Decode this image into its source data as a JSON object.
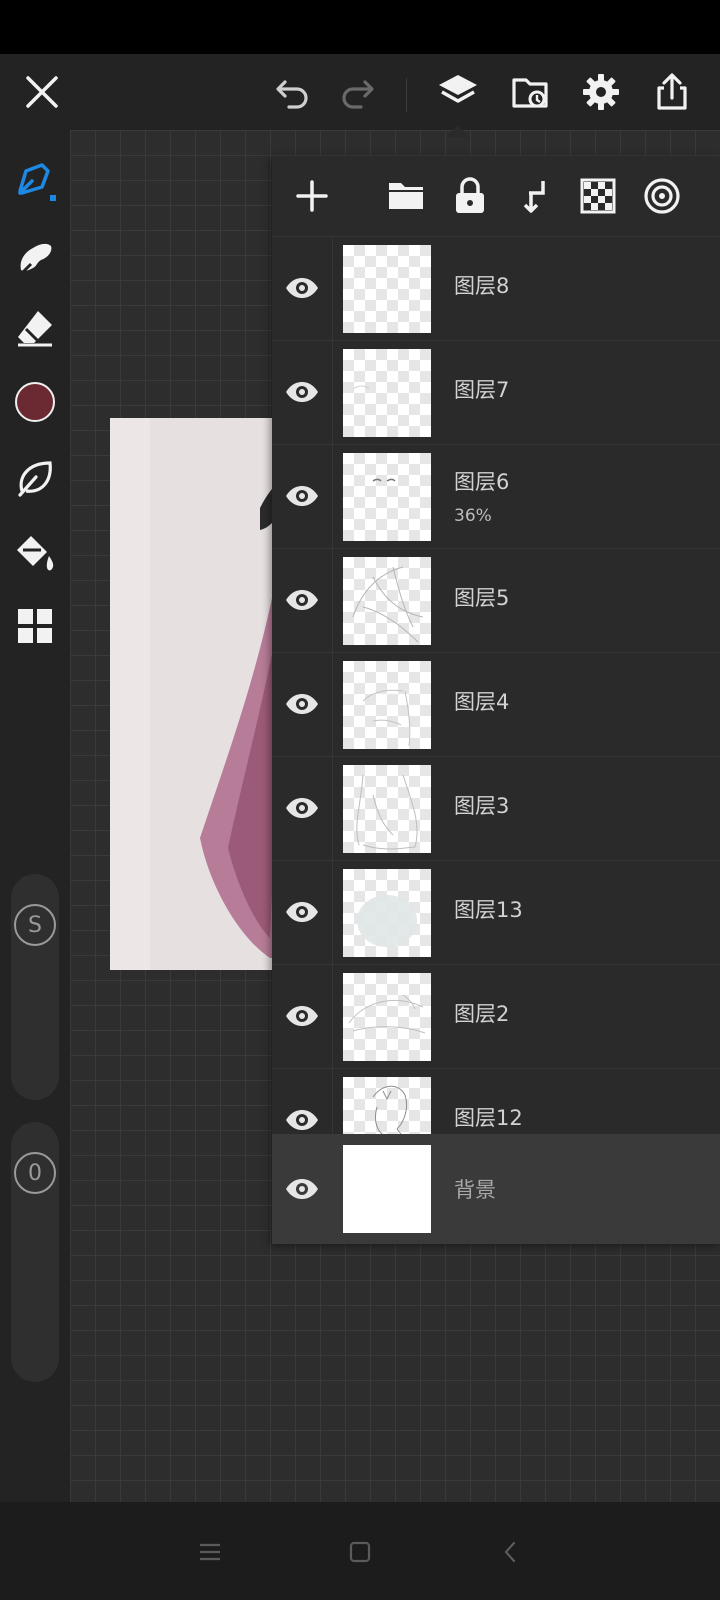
{
  "colors": {
    "accent": "#1e88e5",
    "current_color": "#6b2a32",
    "icon": "#f2f2f2",
    "panel": "#2a2a2a"
  },
  "top_bar": {
    "icons": [
      "close-icon",
      "undo-icon",
      "redo-icon",
      "layers-icon",
      "import-icon",
      "settings-icon",
      "share-icon"
    ]
  },
  "left_toolbar": {
    "tools": [
      "brush-icon",
      "smudge-icon",
      "eraser-icon",
      "color-swatch",
      "lasso-icon",
      "fill-icon",
      "more-icon"
    ],
    "size_slider_label": "S",
    "opacity_slider_label": "0"
  },
  "layers_toolbar": {
    "icons": [
      "add-layer-icon",
      "folder-icon",
      "lock-icon",
      "merge-down-icon",
      "alpha-lock-icon",
      "clipping-icon"
    ]
  },
  "layers": [
    {
      "name": "图层8",
      "opacity": ""
    },
    {
      "name": "图层7",
      "opacity": ""
    },
    {
      "name": "图层6",
      "opacity": "36%"
    },
    {
      "name": "图层5",
      "opacity": ""
    },
    {
      "name": "图层4",
      "opacity": ""
    },
    {
      "name": "图层3",
      "opacity": ""
    },
    {
      "name": "图层13",
      "opacity": ""
    },
    {
      "name": "图层2",
      "opacity": ""
    },
    {
      "name": "图层12",
      "opacity": ""
    }
  ],
  "background_layer": {
    "name": "背景"
  },
  "nav_bar": {
    "icons": [
      "menu-icon",
      "home-icon",
      "back-icon"
    ]
  }
}
